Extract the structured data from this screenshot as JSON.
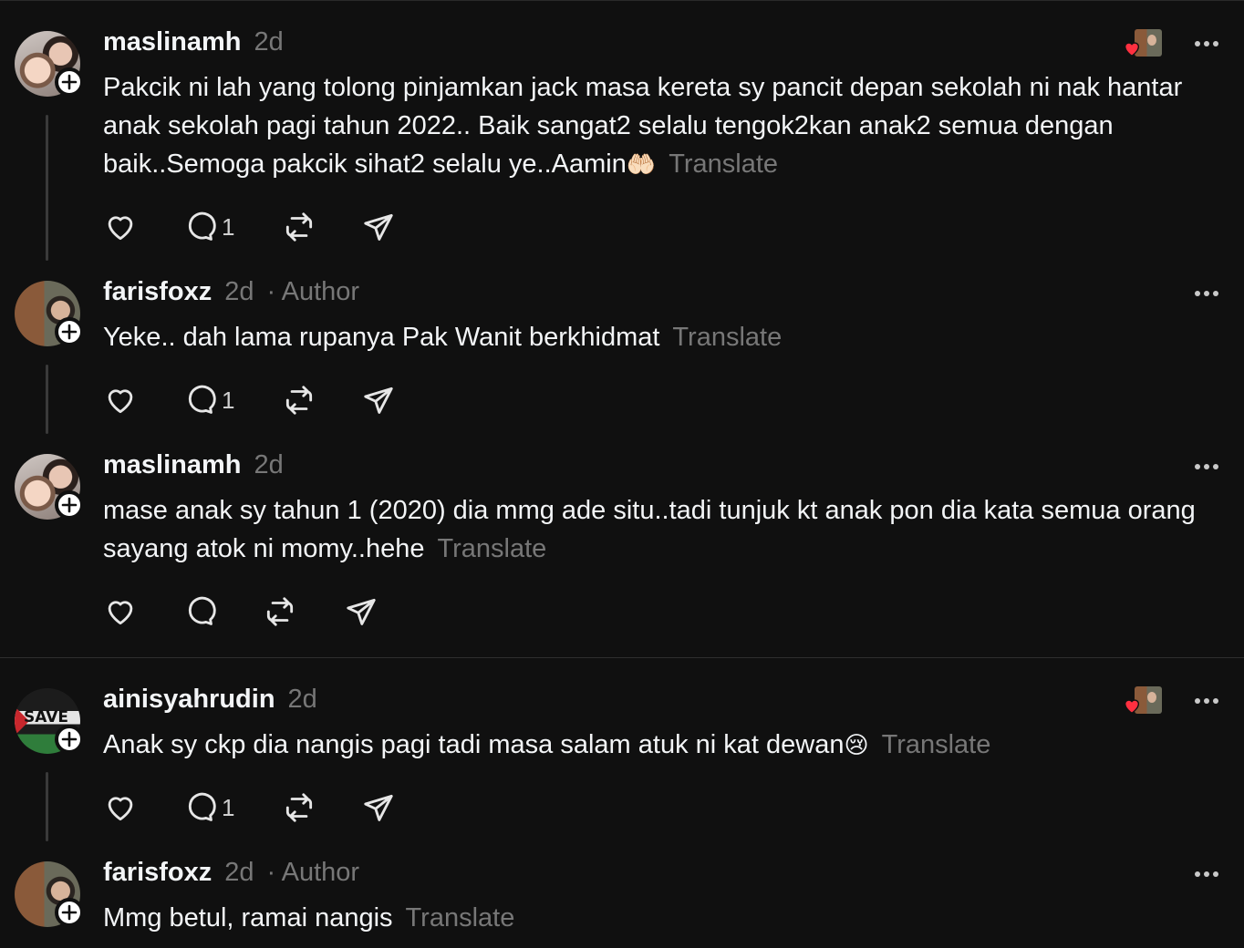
{
  "comments": [
    {
      "username": "maslinamh",
      "time": "2d",
      "author": "",
      "text": "Pakcik ni lah yang tolong pinjamkan jack masa kereta sy pancit depan sekolah ni nak hantar anak sekolah pagi tahun 2022.. Baik sangat2 selalu tengok2kan anak2 semua dengan baik..Semoga pakcik sihat2 selalu ye..Aamin",
      "emoji": "🤲🏻",
      "translate": "Translate",
      "reply_count": "1",
      "liked_by_author": true
    },
    {
      "username": "farisfoxz",
      "time": "2d",
      "author": "· Author",
      "text": "Yeke.. dah lama rupanya Pak Wanit berkhidmat",
      "emoji": "",
      "translate": "Translate",
      "reply_count": "1",
      "liked_by_author": false
    },
    {
      "username": "maslinamh",
      "time": "2d",
      "author": "",
      "text": "mase anak sy tahun 1 (2020) dia mmg ade situ..tadi tunjuk kt anak pon dia kata semua orang sayang atok ni momy..hehe",
      "emoji": "",
      "translate": "Translate",
      "reply_count": "",
      "liked_by_author": false
    },
    {
      "username": "ainisyahrudin",
      "time": "2d",
      "author": "",
      "text": "Anak sy ckp dia nangis pagi tadi masa salam atuk ni kat dewan",
      "emoji": "😢",
      "translate": "Translate",
      "reply_count": "1",
      "liked_by_author": true
    },
    {
      "username": "farisfoxz",
      "time": "2d",
      "author": "· Author",
      "text": "Mmg betul, ramai nangis",
      "emoji": "",
      "translate": "Translate",
      "reply_count": "",
      "liked_by_author": false
    }
  ],
  "avatar_badges": {
    "save_text": "SAVE"
  },
  "icons": [
    "plus-icon",
    "heart-icon",
    "comment-icon",
    "repost-icon",
    "share-icon",
    "more-icon"
  ],
  "colors": {
    "background": "#101010",
    "text": "#f3f5f7",
    "muted": "#777777",
    "like_red": "#ff3040"
  }
}
